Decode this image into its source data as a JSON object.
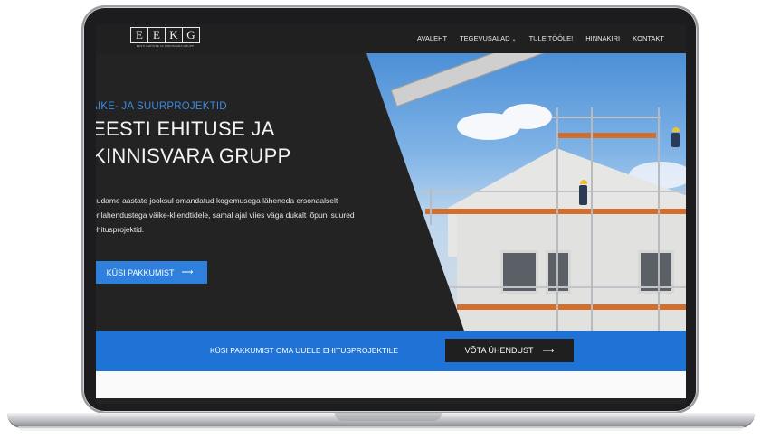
{
  "logo": {
    "letters": [
      "E",
      "E",
      "K",
      "G"
    ],
    "tagline": "EESTI EHITUSE JA KINNISVARA GRUPP"
  },
  "nav": {
    "items": [
      {
        "label": "AVALEHT"
      },
      {
        "label": "TEGEVUSALAD"
      },
      {
        "label": "TULE TÖÖLE!"
      },
      {
        "label": "HINNAKIRI"
      },
      {
        "label": "KONTAKT"
      }
    ]
  },
  "hero": {
    "eyebrow": "ÄIKE- JA SUURPROJEKTID",
    "title_line1": "EESTI EHITUSE JA",
    "title_line2": "KINNISVARA GRUPP",
    "description": "uudame aastate jooksul omandatud kogemusega läheneda ersonaalselt erilahendustega väike-kliendtidele, samal ajal viies väga dukalt lõpuni suured ehitusprojektid.",
    "cta_label": "KÜSI PAKKUMIST"
  },
  "band": {
    "text": "KÜSI PAKKUMIST OMA UUELE EHITUSPROJEKTILE",
    "button_label": "VÕTA ÜHENDUST"
  },
  "icons": {
    "arrow": "arrow-right-icon",
    "caret": "chevron-down-icon"
  },
  "colors": {
    "accent": "#1f72d6",
    "dark": "#232323"
  }
}
